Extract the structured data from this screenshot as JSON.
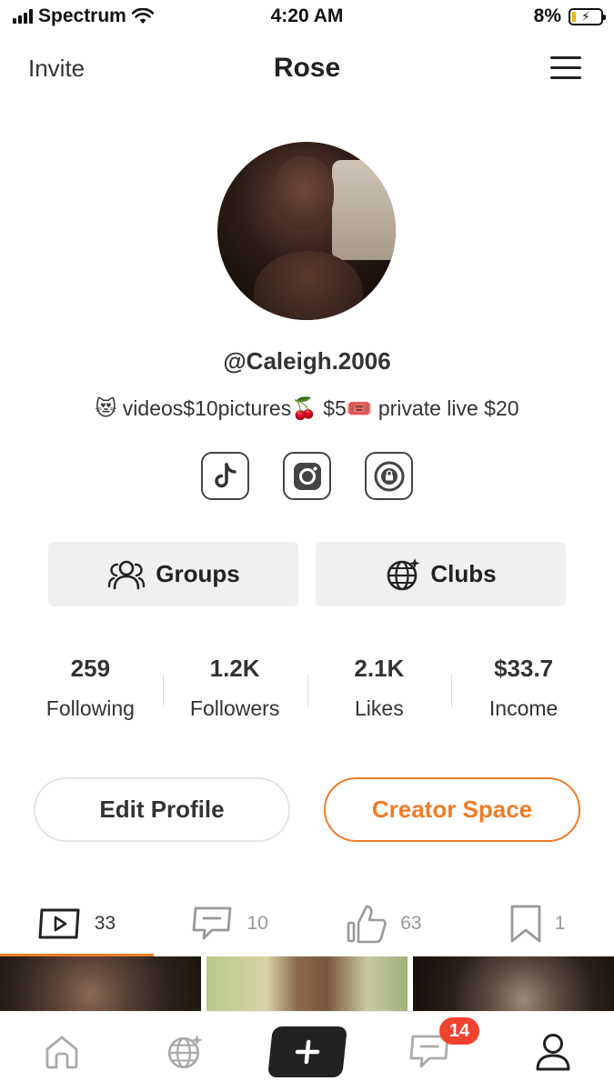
{
  "status_bar": {
    "carrier": "Spectrum",
    "time": "4:20 AM",
    "battery_percent": "8%"
  },
  "header": {
    "invite_label": "Invite",
    "title": "Rose"
  },
  "profile": {
    "username": "@Caleigh.2006",
    "bio": "😻 videos$10pictures🍒 $5🎟️ private live $20",
    "socials": [
      "tiktok-icon",
      "instagram-icon",
      "onlyfans-icon"
    ]
  },
  "buttons": {
    "groups_label": "Groups",
    "clubs_label": "Clubs",
    "edit_profile_label": "Edit Profile",
    "creator_space_label": "Creator Space"
  },
  "stats": [
    {
      "value": "259",
      "label": "Following"
    },
    {
      "value": "1.2K",
      "label": "Followers"
    },
    {
      "value": "2.1K",
      "label": "Likes"
    },
    {
      "value": "$33.7",
      "label": "Income"
    }
  ],
  "tabs": [
    {
      "icon": "video-icon",
      "count": "33",
      "active": true
    },
    {
      "icon": "comment-icon",
      "count": "10",
      "active": false
    },
    {
      "icon": "thumbs-up-icon",
      "count": "63",
      "active": false
    },
    {
      "icon": "bookmark-icon",
      "count": "1",
      "active": false
    }
  ],
  "bottom_nav": {
    "items": [
      "home-icon",
      "globe-icon",
      "plus-icon",
      "messages-icon",
      "profile-icon"
    ],
    "messages_badge": "14"
  },
  "colors": {
    "accent": "#f07c28",
    "badge": "#f0432f",
    "button_bg": "#f0f0f0"
  }
}
